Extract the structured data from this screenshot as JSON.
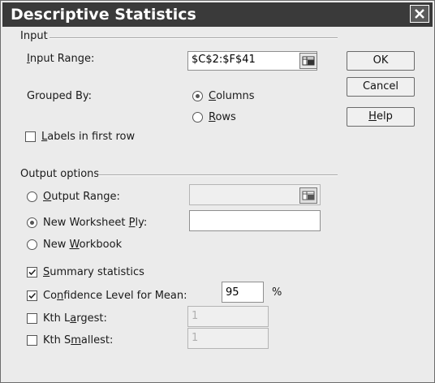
{
  "window": {
    "title": "Descriptive Statistics"
  },
  "input": {
    "section": "Input",
    "range_label": "Input Range:",
    "range_value": "$C$2:$F$41",
    "grouped_label": "Grouped By:",
    "columns": "Columns",
    "rows": "Rows",
    "labels_first_row": "Labels in first row"
  },
  "buttons": {
    "ok": "OK",
    "cancel": "Cancel",
    "help": "Help"
  },
  "output": {
    "section": "Output options",
    "output_range": "Output Range:",
    "new_worksheet": "New Worksheet Ply:",
    "new_workbook": "New Workbook",
    "summary": "Summary statistics",
    "confidence": "Confidence Level for Mean:",
    "confidence_value": "95",
    "percent": "%",
    "kth_largest": "Kth Largest:",
    "kth_largest_value": "1",
    "kth_smallest": "Kth Smallest:",
    "kth_smallest_value": "1"
  }
}
